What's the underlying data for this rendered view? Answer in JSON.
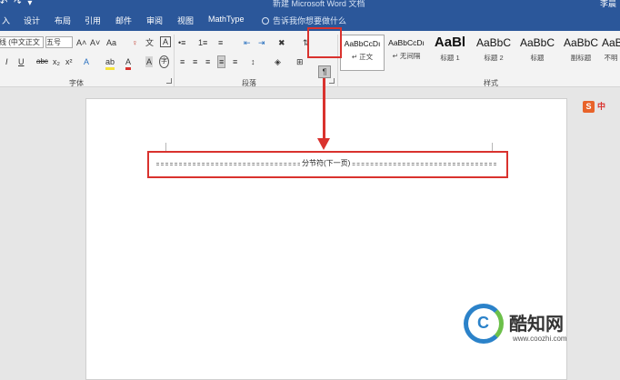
{
  "titlebar": {
    "qat": "↶ ↷ ▾",
    "title": "新建 Microsoft Word 文档",
    "user": "李晨"
  },
  "tabs": [
    "入",
    "设计",
    "布局",
    "引用",
    "邮件",
    "审阅",
    "视图",
    "MathType"
  ],
  "tellme": "告诉我你想要做什么",
  "font": {
    "name": "线 (中文正文",
    "size": "五号",
    "grow": "A˄",
    "shrink": "A˅",
    "case": "Aa",
    "clear": "♀",
    "phonetic": "文",
    "border": "A",
    "italic": "I",
    "underline": "U",
    "strike": "abc",
    "sub": "x₂",
    "sup": "x²",
    "effect": "A",
    "highlight": "ab",
    "color": "A",
    "shade": "A",
    "enclose": "字",
    "group_label": "字体"
  },
  "paragraph": {
    "bullets": "•≡",
    "numbering": "1≡",
    "multilevel": "≡",
    "decrease_indent": "⇤",
    "increase_indent": "⇥",
    "chinese_layout": "✖",
    "sort": "⇅",
    "show_marks": "¶",
    "align_left": "≡",
    "align_center": "≡",
    "align_right": "≡",
    "justify": "≡",
    "distribute": "≡",
    "line_spacing": "↕",
    "shading": "◈",
    "borders": "⊞",
    "group_label": "段落"
  },
  "styles": {
    "items": [
      {
        "preview": "AaBbCcDı",
        "label": "↵ 正文"
      },
      {
        "preview": "AaBbCcDı",
        "label": "↵ 无间隔"
      },
      {
        "preview": "AaBl",
        "label": "标题 1"
      },
      {
        "preview": "AaBbC",
        "label": "标题 2"
      },
      {
        "preview": "AaBbC",
        "label": "标题"
      },
      {
        "preview": "AaBbC",
        "label": "副标题"
      },
      {
        "preview": "AaBbC",
        "label": "不明"
      }
    ],
    "group_label": "样式"
  },
  "document": {
    "section_break": "分节符(下一页)"
  },
  "ime": {
    "logo": "S",
    "mode": "中"
  },
  "watermark": {
    "c": "C",
    "title": "酷知网",
    "url": "www.coozhi.com"
  },
  "colors": {
    "accent": "#2b579a",
    "highlight": "#d9322e"
  }
}
